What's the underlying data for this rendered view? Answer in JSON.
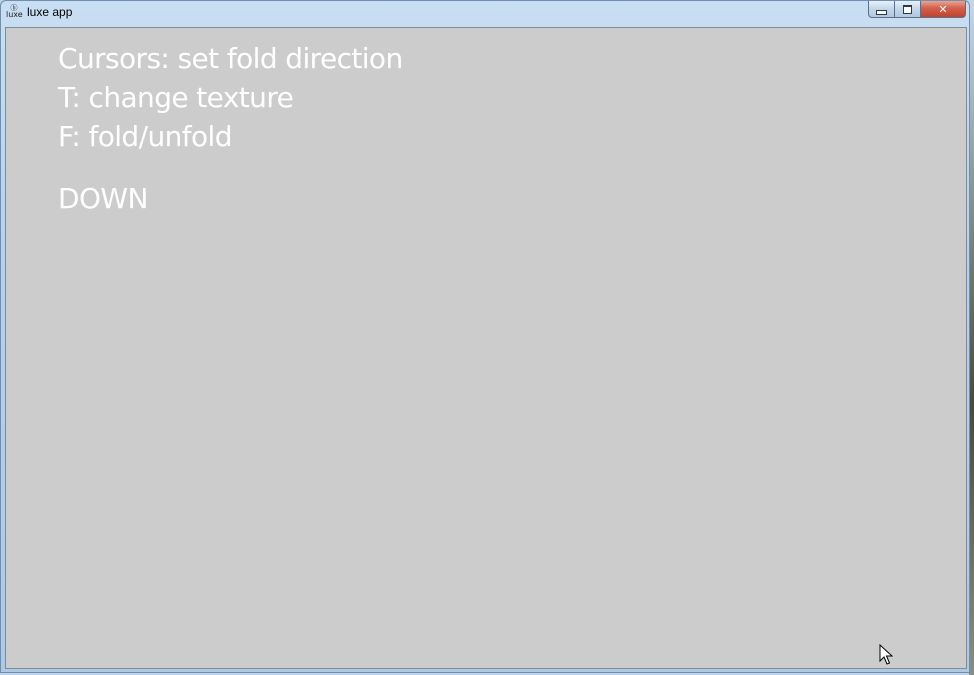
{
  "window": {
    "title": "luxe app",
    "icon": "luxe-icon",
    "icon_text": "luxe",
    "controls": {
      "minimize": "minimize-icon",
      "maximize": "maximize-icon",
      "close": "close-icon",
      "close_glyph": "✕"
    }
  },
  "content": {
    "background": "#cccccc",
    "text_color": "#ffffff",
    "instructions": [
      "Cursors: set fold direction",
      "T: change texture",
      "F: fold/unfold"
    ],
    "direction": "DOWN"
  }
}
